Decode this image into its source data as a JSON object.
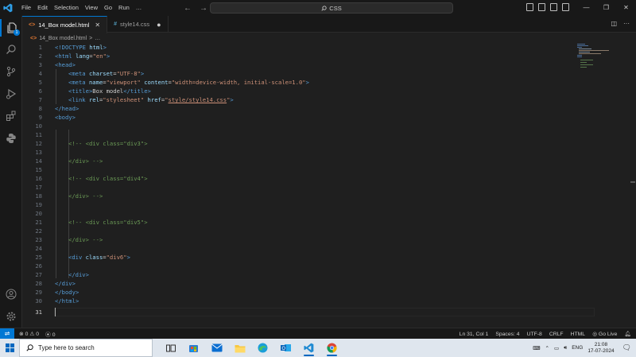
{
  "menu": [
    "File",
    "Edit",
    "Selection",
    "View",
    "Go",
    "Run",
    "…"
  ],
  "search": {
    "label": "CSS"
  },
  "tabs": [
    {
      "label": "14_Box model.html",
      "icon": "html-file-icon",
      "active": true
    },
    {
      "label": "style14.css",
      "icon": "css-file-icon",
      "active": false,
      "modified": true
    }
  ],
  "breadcrumb": {
    "file": "14_Box model.html",
    "sep": ">",
    "rest": "…"
  },
  "activity": {
    "explorer_badge": "1"
  },
  "editor": {
    "current_line": 31,
    "lines": [
      {
        "n": "1"
      },
      {
        "n": "2"
      },
      {
        "n": "3"
      },
      {
        "n": "4"
      },
      {
        "n": "5"
      },
      {
        "n": "6"
      },
      {
        "n": "7"
      },
      {
        "n": "8"
      },
      {
        "n": "9"
      },
      {
        "n": "10"
      },
      {
        "n": "11"
      },
      {
        "n": "12"
      },
      {
        "n": "13"
      },
      {
        "n": "14"
      },
      {
        "n": "15"
      },
      {
        "n": "16"
      },
      {
        "n": "17"
      },
      {
        "n": "18"
      },
      {
        "n": "19"
      },
      {
        "n": "20"
      },
      {
        "n": "21"
      },
      {
        "n": "22"
      },
      {
        "n": "23"
      },
      {
        "n": "24"
      },
      {
        "n": "25"
      },
      {
        "n": "26"
      },
      {
        "n": "27"
      },
      {
        "n": "28"
      },
      {
        "n": "29"
      },
      {
        "n": "30"
      },
      {
        "n": "31"
      }
    ],
    "code": {
      "l1": {
        "a": "<!DOCTYPE ",
        "b": "html",
        "c": ">"
      },
      "l2": {
        "a": "<html ",
        "b": "lang",
        "c": "=",
        "d": "\"en\"",
        "e": ">"
      },
      "l3": "<head>",
      "l4": {
        "a": "<meta ",
        "b": "charset",
        "c": "=",
        "d": "\"UTF-8\"",
        "e": ">"
      },
      "l5": {
        "a": "<meta ",
        "b": "name",
        "c": "=",
        "d": "\"viewport\"",
        "e": " content",
        "f": "=",
        "g": "\"width=device-width, initial-scale=1.0\"",
        "h": ">"
      },
      "l6": {
        "a": "<title>",
        "b": "Box model",
        "c": "</title>"
      },
      "l7": {
        "a": "<link ",
        "b": "rel",
        "c": "=",
        "d": "\"stylesheet\"",
        "e": " href",
        "f": "=",
        "g": "\"",
        "h": "style/style14.css",
        "i": "\"",
        "j": ">"
      },
      "l8": "</head>",
      "l9": "<body>",
      "l12": "<!-- <div class=\"div3\">",
      "l14": "</div> -->",
      "l16": "<!-- <div class=\"div4\">",
      "l18": "</div> -->",
      "l21": "<!-- <div class=\"div5\">",
      "l23": "</div> -->",
      "l25": {
        "a": "<div ",
        "b": "class",
        "c": "=",
        "d": "\"div6\"",
        "e": ">"
      },
      "l27": "</div>",
      "l28": "</div>",
      "l29": "</body>",
      "l30": "</html>"
    }
  },
  "status": {
    "errors": "0",
    "warnings": "0",
    "ports": "0",
    "position": "Ln 31, Col 1",
    "spaces": "Spaces: 4",
    "encoding": "UTF-8",
    "eol": "CRLF",
    "language": "HTML",
    "golive": "Go Live"
  },
  "taskbar": {
    "search_placeholder": "Type here to search",
    "lang": "ENG",
    "time": "21:08",
    "date": "17-07-2024"
  },
  "colors": {
    "accent": "#0078d4",
    "tag": "#569cd6",
    "attr": "#9cdcfe",
    "string": "#ce9178",
    "comment": "#6a9955"
  }
}
